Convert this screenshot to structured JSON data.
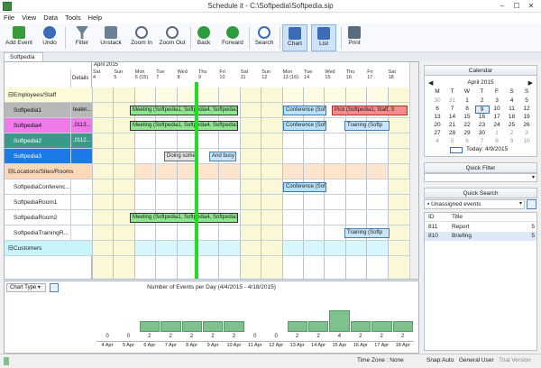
{
  "window": {
    "title": "Schedule it - C:\\Softpedia\\Softpedia.sip",
    "minimize": "–",
    "maximize": "☐",
    "close": "✕"
  },
  "menu": [
    "File",
    "View",
    "Data",
    "Tools",
    "Help"
  ],
  "toolbar": [
    {
      "label": "Add Event",
      "icon": "add-event-icon",
      "color": "#3a9a3a"
    },
    {
      "label": "Undo",
      "icon": "undo-icon",
      "color": "#3a6cb8"
    },
    {
      "label": "Filter",
      "icon": "filter-icon",
      "color": "#6b7f95"
    },
    {
      "label": "Unstack",
      "icon": "unstack-icon",
      "color": "#6b7f95"
    },
    {
      "label": "Zoom In",
      "icon": "zoom-in-icon",
      "color": "#5a6b80"
    },
    {
      "label": "Zoom Out",
      "icon": "zoom-out-icon",
      "color": "#5a6b80"
    },
    {
      "label": "Back",
      "icon": "back-icon",
      "color": "#2e9a3e"
    },
    {
      "label": "Forward",
      "icon": "forward-icon",
      "color": "#2e9a3e"
    },
    {
      "label": "Search",
      "icon": "search-icon",
      "color": "#3a6cb8"
    },
    {
      "label": "Chart",
      "icon": "chart-icon",
      "color": "#3a6cb8",
      "active": true
    },
    {
      "label": "List",
      "icon": "list-icon",
      "color": "#3a6cb8",
      "active": true
    },
    {
      "label": "Print",
      "icon": "print-icon",
      "color": "#5a6b80"
    }
  ],
  "doc_tab": "Softpedia",
  "grid": {
    "month": "April 2015",
    "details_header": "Details",
    "days": [
      {
        "dow": "Sat",
        "d": "4"
      },
      {
        "dow": "Sun",
        "d": "5"
      },
      {
        "dow": "Mon",
        "d": "6 (15)"
      },
      {
        "dow": "Tue",
        "d": "7"
      },
      {
        "dow": "Wed",
        "d": "8"
      },
      {
        "dow": "Thu",
        "d": "9"
      },
      {
        "dow": "Fri",
        "d": "10"
      },
      {
        "dow": "Sat",
        "d": "11"
      },
      {
        "dow": "Sun",
        "d": "12"
      },
      {
        "dow": "Mon",
        "d": "13 (16)"
      },
      {
        "dow": "Tue",
        "d": "14"
      },
      {
        "dow": "Wed",
        "d": "15"
      },
      {
        "dow": "Thu",
        "d": "16"
      },
      {
        "dow": "Fri",
        "d": "17"
      },
      {
        "dow": "Sat",
        "d": "18"
      }
    ],
    "rows": [
      {
        "label": "Employees/Staff",
        "type": "group",
        "color": "#fdfbd8"
      },
      {
        "label": "Softpedia1",
        "details": "teater...",
        "color": "#b8b8b8"
      },
      {
        "label": "Softpedia4",
        "details": ",0113...",
        "color": "#f07ae8"
      },
      {
        "label": "Softpedia2",
        "details": ",0112...",
        "color": "#3a9a8a"
      },
      {
        "label": "Softpedia3",
        "details": "",
        "color": "#1a7ae8"
      },
      {
        "label": "Locations/Sites/Rooms",
        "type": "group",
        "color": "#fbd8b8"
      },
      {
        "label": "SoftpediaConferenc...",
        "details": "",
        "color": "#ffffff"
      },
      {
        "label": "SoftpediaRoom1",
        "details": "",
        "color": "#ffffff"
      },
      {
        "label": "SoftpediaRoom2",
        "details": "",
        "color": "#ffffff"
      },
      {
        "label": "SoftpediaTrainingR...",
        "details": "",
        "color": "#ffffff"
      },
      {
        "label": "Customers",
        "type": "group",
        "color": "#c8f4fc"
      }
    ],
    "events": [
      {
        "text": "Meeting (Softpedia1, Softpedia4, Softpedia1",
        "row": 1,
        "style": "green"
      },
      {
        "text": "Conference (Soft",
        "row": 1,
        "style": "blue"
      },
      {
        "text": "Pick (Softpedia1, Staff, S",
        "row": 1,
        "style": "red"
      },
      {
        "text": "Meeting (Softpedia1, Softpedia4, Softpedia1",
        "row": 2,
        "style": "green"
      },
      {
        "text": "Conference (Soft",
        "row": 2,
        "style": "blue"
      },
      {
        "text": "Training (Softp",
        "row": 2,
        "style": "lblue"
      },
      {
        "text": "Doing some",
        "row": 4,
        "style": "grey"
      },
      {
        "text": "And busy",
        "row": 4,
        "style": "lblue"
      },
      {
        "text": "Conference (Soft",
        "row": 6,
        "style": "blue"
      },
      {
        "text": "Meeting (Softpedia1, Softpedia4, Softpedia1",
        "row": 8,
        "style": "green"
      },
      {
        "text": "Training (Softp",
        "row": 9,
        "style": "lblue"
      }
    ]
  },
  "chart_bar": {
    "chart_type_label": "Chart Type",
    "title": "Number of Events per Day  (4/4/2015 - 4/18/2015)"
  },
  "chart_data": {
    "type": "bar",
    "title": "Number of Events per Day  (4/4/2015 - 4/18/2015)",
    "categories": [
      "4 Apr",
      "5 Apr",
      "6 Apr",
      "7 Apr",
      "8 Apr",
      "9 Apr",
      "10 Apr",
      "11 Apr",
      "12 Apr",
      "13 Apr",
      "14 Apr",
      "15 Apr",
      "16 Apr",
      "17 Apr",
      "18 Apr"
    ],
    "values": [
      0,
      0,
      2,
      2,
      2,
      2,
      2,
      0,
      0,
      2,
      2,
      4,
      2,
      2,
      2
    ],
    "ylim": [
      0,
      4
    ],
    "color": "#7fc08f"
  },
  "calendar": {
    "header": "Calendar",
    "month_label": "April 2015",
    "weekdays": [
      "M",
      "T",
      "W",
      "T",
      "F",
      "S",
      "S"
    ],
    "weeks": [
      [
        "30",
        "31",
        "1",
        "2",
        "3",
        "4",
        "5"
      ],
      [
        "6",
        "7",
        "8",
        "9",
        "10",
        "11",
        "12"
      ],
      [
        "13",
        "14",
        "15",
        "16",
        "17",
        "18",
        "19"
      ],
      [
        "20",
        "21",
        "22",
        "23",
        "24",
        "25",
        "26"
      ],
      [
        "27",
        "28",
        "29",
        "30",
        "1",
        "2",
        "3"
      ],
      [
        "4",
        "5",
        "6",
        "7",
        "8",
        "9",
        "10"
      ]
    ],
    "today_label": "Today: 4/9/2015",
    "selected": "9"
  },
  "quick_filter": {
    "header": "Quick Filter",
    "value": ""
  },
  "quick_search": {
    "header": "Quick Search",
    "selected": "Unassigned events",
    "columns": [
      "ID",
      "Title",
      ""
    ],
    "rows": [
      {
        "id": "811",
        "title": "Report",
        "extra": "5"
      },
      {
        "id": "810",
        "title": "Briefing",
        "extra": "5"
      }
    ]
  },
  "status": {
    "time_zone": "Time Zone : None",
    "snap": "Snap:Auto",
    "user": "General User",
    "version": "Trial Version"
  }
}
